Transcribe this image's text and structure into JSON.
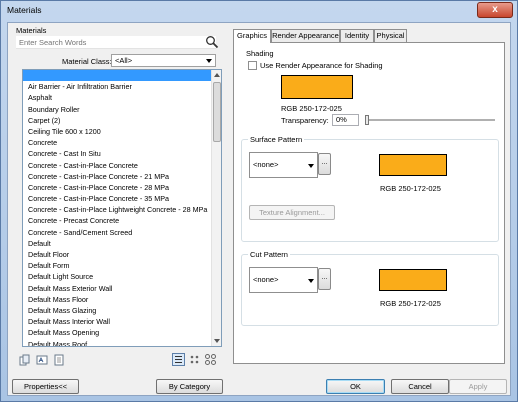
{
  "window": {
    "title": "Materials",
    "close_label": "x"
  },
  "left_pane": {
    "heading": "Materials",
    "search": {
      "placeholder": "Enter Search Words",
      "value": ""
    },
    "material_class": {
      "label": "Material Class:",
      "value": "<All>"
    },
    "items": [
      "",
      "Air Barrier - Air Infiltration Barrier",
      "Asphalt",
      "Boundary Roller",
      "Carpet (2)",
      "Ceiling Tile 600 x 1200",
      "Concrete",
      "Concrete - Cast In Situ",
      "Concrete - Cast-in-Place Concrete",
      "Concrete - Cast-in-Place Concrete - 21 MPa",
      "Concrete - Cast-in-Place Concrete - 28 MPa",
      "Concrete - Cast-in-Place Concrete - 35 MPa",
      "Concrete - Cast-in-Place Lightweight Concrete - 28 MPa",
      "Concrete - Precast Concrete",
      "Concrete - Sand/Cement Screed",
      "Default",
      "Default Floor",
      "Default Form",
      "Default Light Source",
      "Default Mass Exterior Wall",
      "Default Mass Floor",
      "Default Mass Glazing",
      "Default Mass Interior Wall",
      "Default Mass Opening",
      "Default Mass Roof"
    ],
    "selected_index": 0
  },
  "tabs": [
    {
      "label": "Graphics",
      "active": true
    },
    {
      "label": "Render Appearance",
      "active": false
    },
    {
      "label": "Identity",
      "active": false
    },
    {
      "label": "Physical",
      "active": false
    }
  ],
  "graphics": {
    "shading": {
      "title": "Shading",
      "use_render_label": "Use Render Appearance for Shading",
      "use_render_checked": false,
      "color_text": "RGB 250-172-025",
      "color_hex": "#faac19",
      "transparency_label": "Transparency:",
      "transparency_value": "0%",
      "transparency_level": 0
    },
    "surface_pattern": {
      "title": "Surface Pattern",
      "pattern_value": "<none>",
      "browse_label": "...",
      "color_text": "RGB 250-172-025",
      "color_hex": "#faac19",
      "alignment_button": "Texture Alignment..."
    },
    "cut_pattern": {
      "title": "Cut Pattern",
      "pattern_value": "<none>",
      "browse_label": "...",
      "color_text": "RGB 250-172-025",
      "color_hex": "#faac19"
    }
  },
  "footer": {
    "properties_button": "Properties<<",
    "by_category_button": "By Category",
    "ok_button": "OK",
    "cancel_button": "Cancel",
    "apply_button": "Apply"
  }
}
